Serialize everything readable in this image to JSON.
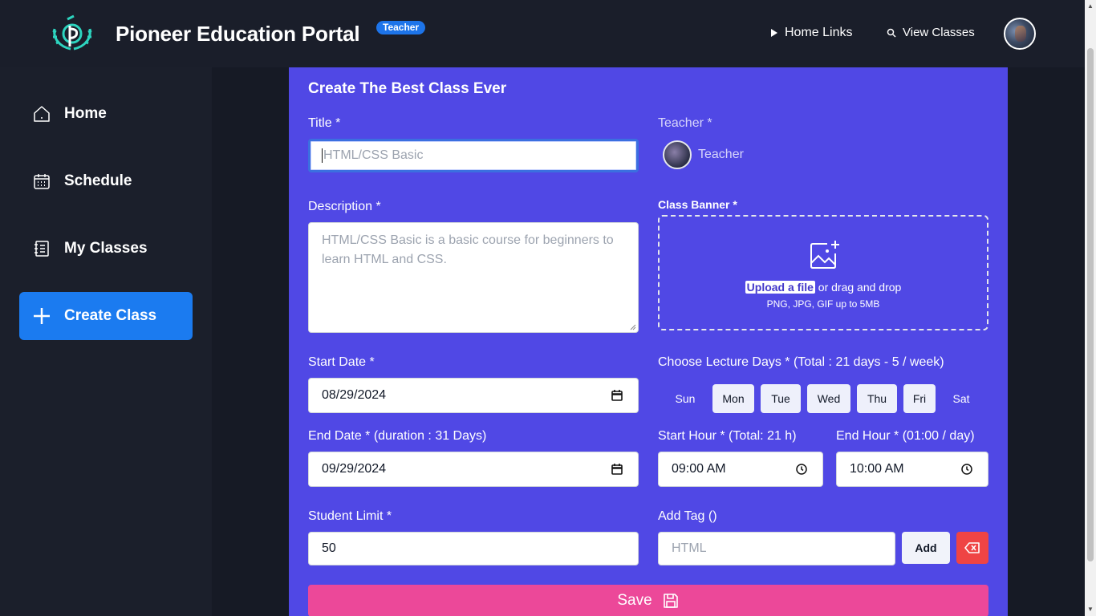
{
  "header": {
    "brand": "Pioneer Education Portal",
    "role_badge": "Teacher",
    "nav": [
      {
        "label": "Home Links",
        "icon": "play-icon"
      },
      {
        "label": "View Classes",
        "icon": "search-icon"
      }
    ]
  },
  "sidebar": {
    "items": [
      {
        "label": "Home",
        "icon": "home-icon",
        "active": false
      },
      {
        "label": "Schedule",
        "icon": "calendar-icon",
        "active": false
      },
      {
        "label": "My Classes",
        "icon": "notebook-icon",
        "active": false
      },
      {
        "label": "Create Class",
        "icon": "plus-icon",
        "active": true
      }
    ]
  },
  "form": {
    "heading": "Create The Best Class Ever",
    "title": {
      "label": "Title *",
      "placeholder": "HTML/CSS Basic",
      "value": ""
    },
    "teacher": {
      "label": "Teacher *",
      "name": "Teacher"
    },
    "description": {
      "label": "Description *",
      "placeholder": "HTML/CSS Basic is a basic course for beginners to learn HTML and CSS."
    },
    "banner": {
      "label": "Class Banner *",
      "upload_link": "Upload a file",
      "upload_text": "or drag and drop",
      "hint": "PNG, JPG, GIF up to 5MB"
    },
    "start_date": {
      "label": "Start Date *",
      "value": "08/29/2024"
    },
    "lecture_days": {
      "label": "Choose Lecture Days * (Total : 21 days - 5 / week)",
      "days": [
        {
          "label": "Sun",
          "selected": false
        },
        {
          "label": "Mon",
          "selected": true
        },
        {
          "label": "Tue",
          "selected": true
        },
        {
          "label": "Wed",
          "selected": true
        },
        {
          "label": "Thu",
          "selected": true
        },
        {
          "label": "Fri",
          "selected": true
        },
        {
          "label": "Sat",
          "selected": false
        }
      ]
    },
    "end_date": {
      "label": "End Date * (duration : 31 Days)",
      "value": "09/29/2024"
    },
    "start_hour": {
      "label": "Start Hour * (Total: 21 h)",
      "value": "09:00 AM"
    },
    "end_hour": {
      "label": "End Hour * (01:00 / day)",
      "value": "10:00 AM"
    },
    "student_limit": {
      "label": "Student Limit *",
      "value": "50"
    },
    "tag": {
      "label": "Add Tag ()",
      "placeholder": "HTML",
      "add_label": "Add"
    },
    "save_label": "Save"
  },
  "colors": {
    "header_bg": "#1a1e2a",
    "card_bg": "#5048e5",
    "active_nav": "#1b7bf0",
    "save": "#ec4899",
    "danger": "#ef4444",
    "badge": "#1d74e9"
  }
}
